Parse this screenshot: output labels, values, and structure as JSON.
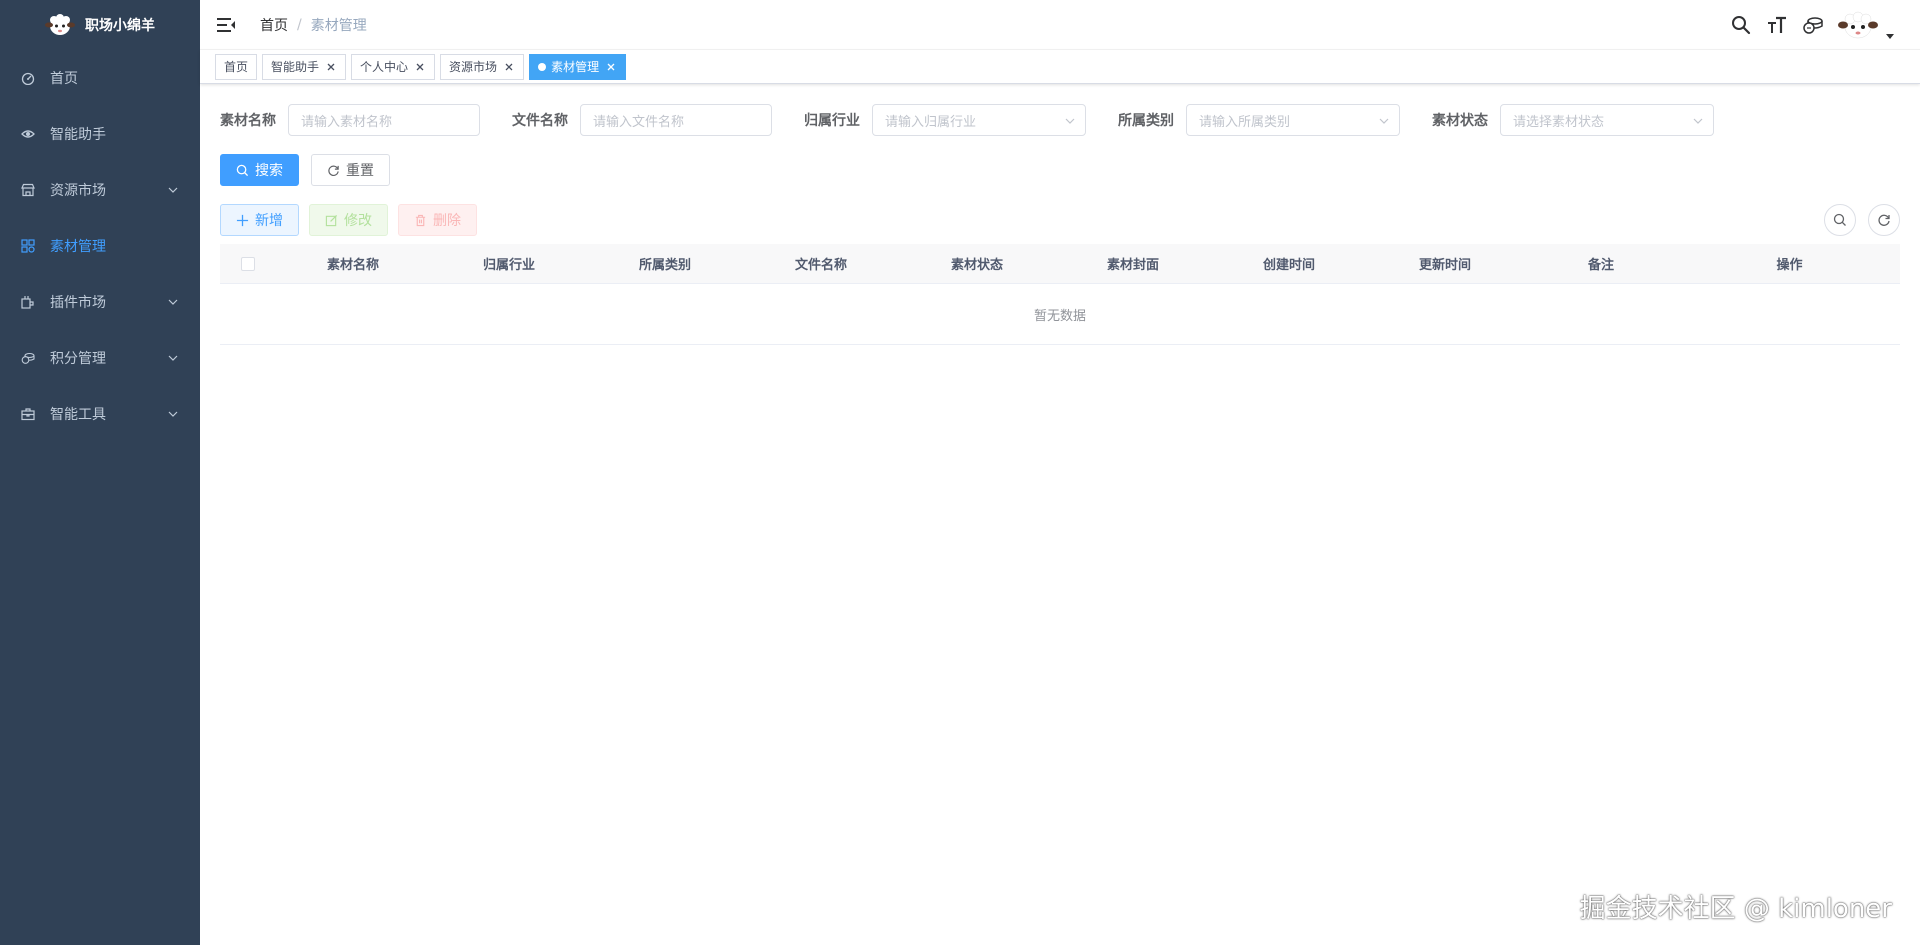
{
  "app": {
    "title": "职场小绵羊",
    "logo_icon": "sheep-logo-icon"
  },
  "sidebar": {
    "items": [
      {
        "label": "首页",
        "icon": "dashboard-icon",
        "active": false,
        "has_arrow": false
      },
      {
        "label": "智能助手",
        "icon": "eye-icon",
        "active": false,
        "has_arrow": false
      },
      {
        "label": "资源市场",
        "icon": "shop-icon",
        "active": false,
        "has_arrow": true
      },
      {
        "label": "素材管理",
        "icon": "material-icon",
        "active": true,
        "has_arrow": false
      },
      {
        "label": "插件市场",
        "icon": "plugin-icon",
        "active": false,
        "has_arrow": true
      },
      {
        "label": "积分管理",
        "icon": "coins-icon",
        "active": false,
        "has_arrow": true
      },
      {
        "label": "智能工具",
        "icon": "toolbox-icon",
        "active": false,
        "has_arrow": true
      }
    ]
  },
  "navbar": {
    "breadcrumb": {
      "home": "首页",
      "separator": "/",
      "current": "素材管理"
    }
  },
  "tags": [
    {
      "label": "首页",
      "closable": false,
      "active": false
    },
    {
      "label": "智能助手",
      "closable": true,
      "active": false
    },
    {
      "label": "个人中心",
      "closable": true,
      "active": false
    },
    {
      "label": "资源市场",
      "closable": true,
      "active": false
    },
    {
      "label": "素材管理",
      "closable": true,
      "active": true
    }
  ],
  "search_form": {
    "fields": [
      {
        "label": "素材名称",
        "placeholder": "请输入素材名称",
        "type": "input"
      },
      {
        "label": "文件名称",
        "placeholder": "请输入文件名称",
        "type": "input"
      },
      {
        "label": "归属行业",
        "placeholder": "请输入归属行业",
        "type": "select"
      },
      {
        "label": "所属类别",
        "placeholder": "请输入所属类别",
        "type": "select"
      },
      {
        "label": "素材状态",
        "placeholder": "请选择素材状态",
        "type": "select"
      }
    ],
    "search_label": "搜索",
    "reset_label": "重置"
  },
  "toolbar": {
    "add_label": "新增",
    "edit_label": "修改",
    "delete_label": "删除"
  },
  "table": {
    "columns": [
      "素材名称",
      "归属行业",
      "所属类别",
      "文件名称",
      "素材状态",
      "素材封面",
      "创建时间",
      "更新时间",
      "备注",
      "操作"
    ],
    "empty_text": "暂无数据"
  },
  "watermark": "掘金技术社区 @ kimloner",
  "colors": {
    "sidebar_bg": "#304156",
    "primary": "#409eff",
    "tag_active": "#42a5f5"
  }
}
